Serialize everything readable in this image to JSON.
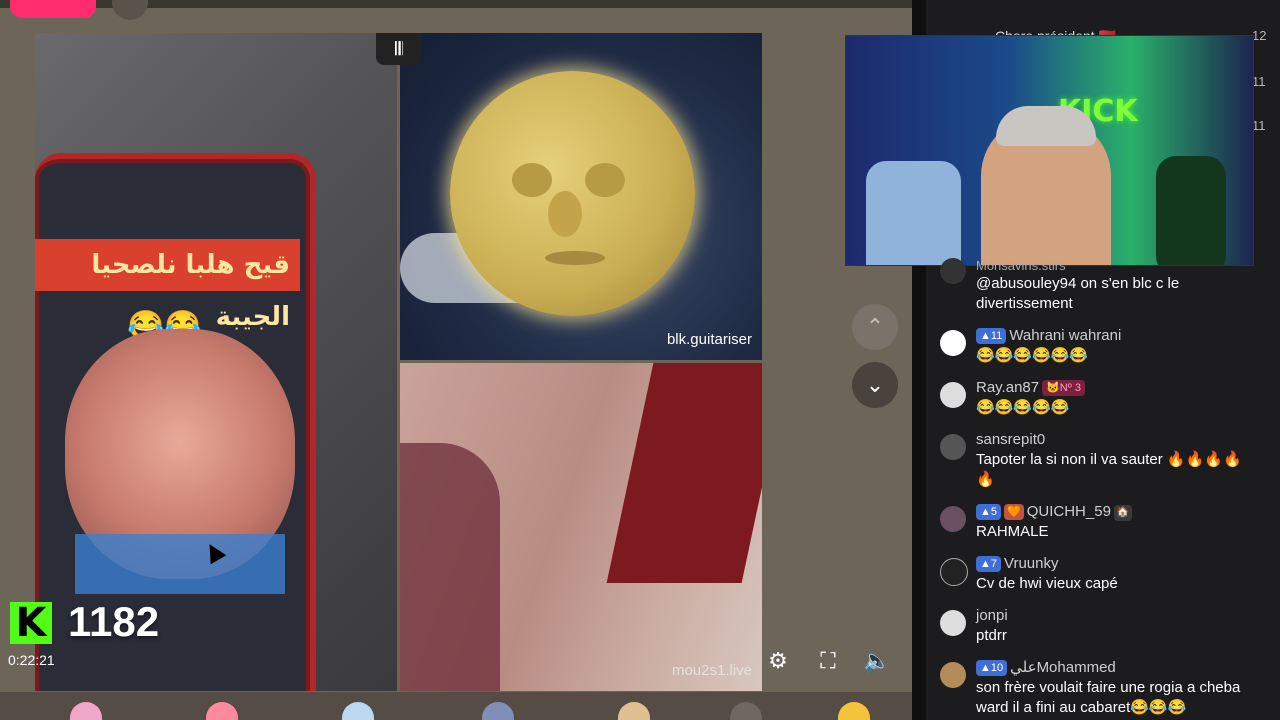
{
  "stream": {
    "viewer_count": "1182",
    "timestamp": "0:22:21",
    "watermark_top_right": "blk.guitariser",
    "watermark_bottom_right": "mou2s1.live",
    "phone_banner_text": "قيح هلبا نلصحيا الجيبة",
    "audio_glyph": "𝄃𝄃",
    "kick_letter": "K"
  },
  "controls": {
    "up_glyph": "⌃",
    "down_glyph": "⌄",
    "settings_glyph": "⚙",
    "fullscreen_glyph": "⛶",
    "volume_glyph": "🔈"
  },
  "webcam": {
    "kick_sign": "KICK"
  },
  "chat": {
    "partial_top": {
      "user": "Chore président 🇲🇦",
      "count": "12"
    },
    "side_counts": [
      "11",
      "11"
    ],
    "partial_user": "Monsavins.stirs",
    "messages": [
      {
        "user": "",
        "text": "@abusouley94 on s'en blc c le divertissement"
      },
      {
        "badge": "11",
        "user": "Wahrani wahrani",
        "text": "😂😂😂😂😂😂"
      },
      {
        "user": "Ray.an87",
        "rank": "🐱Nº 3",
        "text": "😂😂😂😂😂"
      },
      {
        "user": "sansrepit0",
        "text": "Tapoter la si non il va sauter 🔥🔥🔥🔥🔥"
      },
      {
        "badge": "5",
        "heart": "🧡",
        "user": "QUICHH_59",
        "home": "🏠",
        "text": "RAHMALE"
      },
      {
        "badge": "7",
        "user": "Vruunky",
        "text": "Cv de hwi vieux capé"
      },
      {
        "user": "jonpi",
        "text": "ptdrr"
      },
      {
        "badge": "10",
        "user": "عليMohammed",
        "text": "son frère voulait faire une rogia a cheba ward il a fini au cabaret😂😂😂"
      }
    ]
  },
  "colors": {
    "kick_green": "#53fc18",
    "badge_blue": "#3f6ed6",
    "live_pink": "#ff2d6e"
  }
}
